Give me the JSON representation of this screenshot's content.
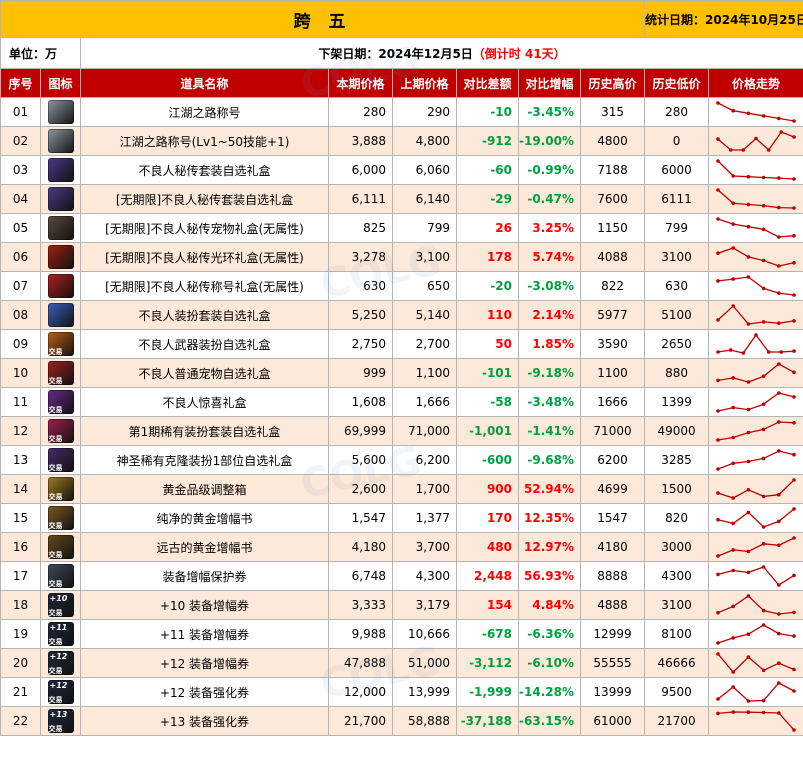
{
  "header": {
    "title": "跨 五",
    "stat_date": "统计日期：2024年10月25日",
    "unit": "单位：万",
    "offshelf_prefix": "下架日期：2024年12月5日",
    "countdown": "（倒计时 41天）"
  },
  "columns": [
    "序号",
    "图标",
    "道具名称",
    "本期价格",
    "上期价格",
    "对比差额",
    "对比增幅",
    "历史高价",
    "历史低价",
    "价格走势"
  ],
  "colors": {
    "title_bg": "#ffc000",
    "header_bg": "#c00000",
    "row_alt": "#fde9d9",
    "up": "#ff0000",
    "down": "#00a040",
    "spark": "#c00000"
  },
  "rows": [
    {
      "no": "01",
      "icon": "jianghu-title-icon",
      "icon_bg": "#8a9aa0",
      "tag": "",
      "plus": "",
      "name": "江湖之路称号",
      "cur": "280",
      "prev": "290",
      "diff": "-10",
      "pct": "-3.45%",
      "high": "315",
      "low": "280",
      "trend": [
        315,
        300,
        295,
        290,
        285,
        280
      ]
    },
    {
      "no": "02",
      "icon": "jianghu-title-icon",
      "icon_bg": "#8a9aa0",
      "tag": "",
      "plus": "",
      "name": "江湖之路称号(Lv1~50技能+1)",
      "cur": "3,888",
      "prev": "4,800",
      "diff": "-912",
      "pct": "-19.00%",
      "high": "4800",
      "low": "0",
      "trend": [
        3500,
        1500,
        1500,
        3600,
        1500,
        4800,
        3888
      ]
    },
    {
      "no": "03",
      "icon": "costume-box-icon",
      "icon_bg": "#4a3a8a",
      "tag": "",
      "plus": "",
      "name": "不良人秘传套装自选礼盒",
      "cur": "6,000",
      "prev": "6,060",
      "diff": "-60",
      "pct": "-0.99%",
      "high": "7188",
      "low": "6000",
      "trend": [
        7188,
        6200,
        6150,
        6100,
        6060,
        6000
      ]
    },
    {
      "no": "04",
      "icon": "costume-box-icon",
      "icon_bg": "#4a3a8a",
      "tag": "",
      "plus": "",
      "name": "[无期限]不良人秘传套装自选礼盒",
      "cur": "6,111",
      "prev": "6,140",
      "diff": "-29",
      "pct": "-0.47%",
      "high": "7600",
      "low": "6111",
      "trend": [
        7600,
        6500,
        6400,
        6300,
        6140,
        6111
      ]
    },
    {
      "no": "05",
      "icon": "pet-box-icon",
      "icon_bg": "#5a4a3a",
      "tag": "",
      "plus": "",
      "name": "[无期限]不良人秘传宠物礼盒(无属性)",
      "cur": "825",
      "prev": "799",
      "diff": "26",
      "pct": "3.25%",
      "high": "1150",
      "low": "799",
      "trend": [
        1150,
        1050,
        1000,
        950,
        799,
        825
      ]
    },
    {
      "no": "06",
      "icon": "aura-box-icon",
      "icon_bg": "#a02010",
      "tag": "",
      "plus": "",
      "name": "[无期限]不良人秘传光环礼盒(无属性)",
      "cur": "3,278",
      "prev": "3,100",
      "diff": "178",
      "pct": "5.74%",
      "high": "4088",
      "low": "3100",
      "trend": [
        3800,
        4088,
        3600,
        3400,
        3100,
        3278
      ]
    },
    {
      "no": "07",
      "icon": "title-box-icon",
      "icon_bg": "#b02020",
      "tag": "",
      "plus": "",
      "name": "[无期限]不良人秘传称号礼盒(无属性)",
      "cur": "630",
      "prev": "650",
      "diff": "-20",
      "pct": "-3.08%",
      "high": "822",
      "low": "630",
      "trend": [
        780,
        800,
        822,
        700,
        650,
        630
      ]
    },
    {
      "no": "08",
      "icon": "suit-box-icon",
      "icon_bg": "#3a60c0",
      "tag": "",
      "plus": "",
      "name": "不良人装扮套装自选礼盒",
      "cur": "5,250",
      "prev": "5,140",
      "diff": "110",
      "pct": "2.14%",
      "high": "5977",
      "low": "5100",
      "trend": [
        5300,
        5977,
        5100,
        5200,
        5140,
        5250
      ]
    },
    {
      "no": "09",
      "icon": "weapon-box-icon",
      "icon_bg": "#c06010",
      "tag": "交易",
      "plus": "",
      "name": "不良人武器装扮自选礼盒",
      "cur": "2,750",
      "prev": "2,700",
      "diff": "50",
      "pct": "1.85%",
      "high": "3590",
      "low": "2650",
      "trend": [
        2700,
        2800,
        2650,
        3590,
        2700,
        2700,
        2750
      ]
    },
    {
      "no": "10",
      "icon": "pet-select-box-icon",
      "icon_bg": "#a02020",
      "tag": "交易",
      "plus": "",
      "name": "不良人普通宠物自选礼盒",
      "cur": "999",
      "prev": "1,100",
      "diff": "-101",
      "pct": "-9.18%",
      "high": "1100",
      "low": "880",
      "trend": [
        900,
        930,
        880,
        950,
        1100,
        999
      ]
    },
    {
      "no": "11",
      "icon": "surprise-box-icon",
      "icon_bg": "#6a2a8a",
      "tag": "交易",
      "plus": "",
      "name": "不良人惊喜礼盒",
      "cur": "1,608",
      "prev": "1,666",
      "diff": "-58",
      "pct": "-3.48%",
      "high": "1666",
      "low": "1399",
      "trend": [
        1399,
        1450,
        1420,
        1500,
        1666,
        1608
      ]
    },
    {
      "no": "12",
      "icon": "rare-costume-box-icon",
      "icon_bg": "#a02050",
      "tag": "交易",
      "plus": "",
      "name": "第1期稀有装扮套装自选礼盒",
      "cur": "69,999",
      "prev": "71,000",
      "diff": "-1,001",
      "pct": "-1.41%",
      "high": "71000",
      "low": "49000",
      "trend": [
        49000,
        52000,
        58000,
        62000,
        71000,
        69999
      ]
    },
    {
      "no": "13",
      "icon": "clone-box-icon",
      "icon_bg": "#4a2a6a",
      "tag": "交易",
      "plus": "",
      "name": "神圣稀有克隆装扮1部位自选礼盒",
      "cur": "5,600",
      "prev": "6,200",
      "diff": "-600",
      "pct": "-9.68%",
      "high": "6200",
      "low": "3285",
      "trend": [
        3285,
        4200,
        4500,
        5000,
        6200,
        5600
      ]
    },
    {
      "no": "14",
      "icon": "gold-box-icon",
      "icon_bg": "#a07a20",
      "tag": "交易",
      "plus": "",
      "name": "黄金品级调整箱",
      "cur": "2,600",
      "prev": "1,700",
      "diff": "900",
      "pct": "52.94%",
      "high": "4699",
      "low": "1500",
      "trend": [
        1800,
        1500,
        2000,
        1600,
        1700,
        2600
      ]
    },
    {
      "no": "15",
      "icon": "pure-gold-book-icon",
      "icon_bg": "#7a5a20",
      "tag": "交易",
      "plus": "",
      "name": "纯净的黄金增幅书",
      "cur": "1,547",
      "prev": "1,377",
      "diff": "170",
      "pct": "12.35%",
      "high": "1547",
      "low": "820",
      "trend": [
        1400,
        1350,
        1500,
        1300,
        1377,
        1547
      ]
    },
    {
      "no": "16",
      "icon": "ancient-gold-book-icon",
      "icon_bg": "#6a4a1a",
      "tag": "交易",
      "plus": "",
      "name": "远古的黄金增幅书",
      "cur": "4,180",
      "prev": "3,700",
      "diff": "480",
      "pct": "12.97%",
      "high": "4180",
      "low": "3000",
      "trend": [
        3000,
        3400,
        3300,
        3800,
        3700,
        4180
      ]
    },
    {
      "no": "17",
      "icon": "protect-ticket-icon",
      "icon_bg": "#404858",
      "tag": "交易",
      "plus": "",
      "name": "装备增幅保护券",
      "cur": "6,748",
      "prev": "4,300",
      "diff": "2,448",
      "pct": "56.93%",
      "high": "8888",
      "low": "4300",
      "trend": [
        7000,
        8000,
        7500,
        8888,
        4300,
        6748
      ]
    },
    {
      "no": "18",
      "icon": "amp10-ticket-icon",
      "icon_bg": "#20283a",
      "tag": "交易",
      "plus": "+10",
      "name": "+10 装备增幅券",
      "cur": "3,333",
      "prev": "3,179",
      "diff": "154",
      "pct": "4.84%",
      "high": "4888",
      "low": "3100",
      "trend": [
        3300,
        3900,
        4888,
        3500,
        3179,
        3333
      ]
    },
    {
      "no": "19",
      "icon": "amp11-ticket-icon",
      "icon_bg": "#20283a",
      "tag": "交易",
      "plus": "+11",
      "name": "+11 装备增幅券",
      "cur": "9,988",
      "prev": "10,666",
      "diff": "-678",
      "pct": "-6.36%",
      "high": "12999",
      "low": "8100",
      "trend": [
        8100,
        9500,
        10500,
        12999,
        10666,
        9988
      ]
    },
    {
      "no": "20",
      "icon": "amp12-ticket-icon",
      "icon_bg": "#20283a",
      "tag": "交易",
      "plus": "+12",
      "name": "+12 装备增幅券",
      "cur": "47,888",
      "prev": "51,000",
      "diff": "-3,112",
      "pct": "-6.10%",
      "high": "55555",
      "low": "46666",
      "trend": [
        55555,
        46666,
        54000,
        47500,
        51000,
        47888
      ]
    },
    {
      "no": "21",
      "icon": "reinforce12-ticket-icon",
      "icon_bg": "#20283a",
      "tag": "交易",
      "plus": "+12",
      "name": "+12 装备强化券",
      "cur": "12,000",
      "prev": "13,999",
      "diff": "-1,999",
      "pct": "-14.28%",
      "high": "13999",
      "low": "9500",
      "trend": [
        10000,
        13000,
        9500,
        9600,
        13999,
        12000
      ]
    },
    {
      "no": "22",
      "icon": "reinforce13-ticket-icon",
      "icon_bg": "#20283a",
      "tag": "交易",
      "plus": "+13",
      "name": "+13 装备强化券",
      "cur": "21,700",
      "prev": "58,888",
      "diff": "-37,188",
      "pct": "-63.15%",
      "high": "61000",
      "low": "21700",
      "trend": [
        58000,
        61000,
        60500,
        60000,
        58888,
        21700
      ]
    }
  ]
}
